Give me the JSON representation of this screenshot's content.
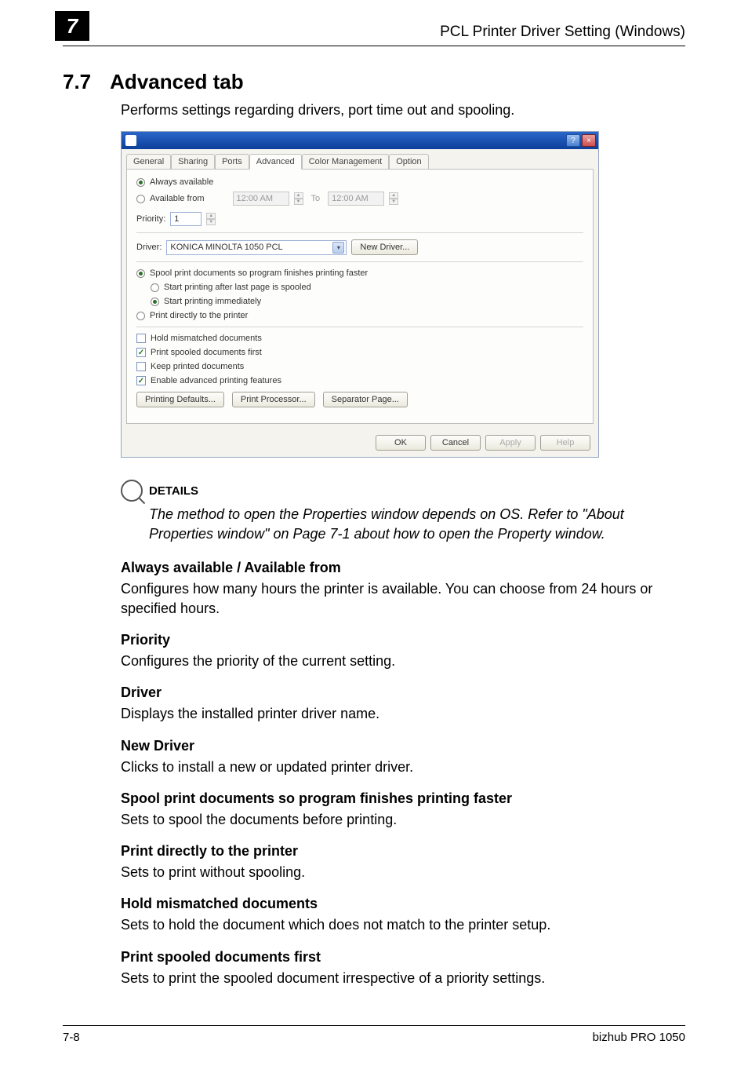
{
  "header": {
    "chapter_num": "7",
    "title_right": "PCL Printer Driver Setting (Windows)"
  },
  "section": {
    "number": "7.7",
    "title": "Advanced tab",
    "intro": "Performs settings regarding drivers, port time out and spooling."
  },
  "dialog": {
    "tabs": [
      "General",
      "Sharing",
      "Ports",
      "Advanced",
      "Color Management",
      "Option"
    ],
    "active_tab": "Advanced",
    "always_available": "Always available",
    "available_from": "Available from",
    "time_from": "12:00 AM",
    "to_label": "To",
    "time_to": "12:00 AM",
    "priority_label": "Priority:",
    "priority_value": "1",
    "driver_label": "Driver:",
    "driver_value": "KONICA MINOLTA 1050 PCL",
    "new_driver_btn": "New Driver...",
    "spool_main": "Spool print documents so program finishes printing faster",
    "spool_after_last": "Start printing after last page is spooled",
    "spool_immediate": "Start printing immediately",
    "print_direct": "Print directly to the printer",
    "hold_mismatch": "Hold mismatched documents",
    "print_spooled_first": "Print spooled documents first",
    "keep_printed": "Keep printed documents",
    "enable_adv": "Enable advanced printing features",
    "printing_defaults_btn": "Printing Defaults...",
    "print_processor_btn": "Print Processor...",
    "separator_page_btn": "Separator Page...",
    "ok_btn": "OK",
    "cancel_btn": "Cancel",
    "apply_btn": "Apply",
    "help_btn": "Help"
  },
  "details": {
    "heading": "DETAILS",
    "text": "The method to open the Properties window depends on OS. Refer to \"About Properties window\" on Page 7-1 about how to open the Property window."
  },
  "definitions": [
    {
      "term": "Always available / Available from",
      "desc": "Configures how many hours the printer is available. You can choose from 24 hours or specified hours."
    },
    {
      "term": "Priority",
      "desc": "Configures the priority of the current setting."
    },
    {
      "term": "Driver",
      "desc": "Displays the installed printer driver name."
    },
    {
      "term": "New Driver",
      "desc": "Clicks to install a new or updated printer driver."
    },
    {
      "term": "Spool print documents so program finishes printing faster",
      "desc": "Sets to spool the documents before printing."
    },
    {
      "term": "Print directly to the printer",
      "desc": "Sets to print without spooling."
    },
    {
      "term": "Hold mismatched documents",
      "desc": "Sets to hold the document which does not match to the printer setup."
    },
    {
      "term": "Print spooled documents first",
      "desc": "Sets to print the spooled document irrespective of a priority settings."
    }
  ],
  "footer": {
    "page": "7-8",
    "product": "bizhub PRO 1050"
  }
}
